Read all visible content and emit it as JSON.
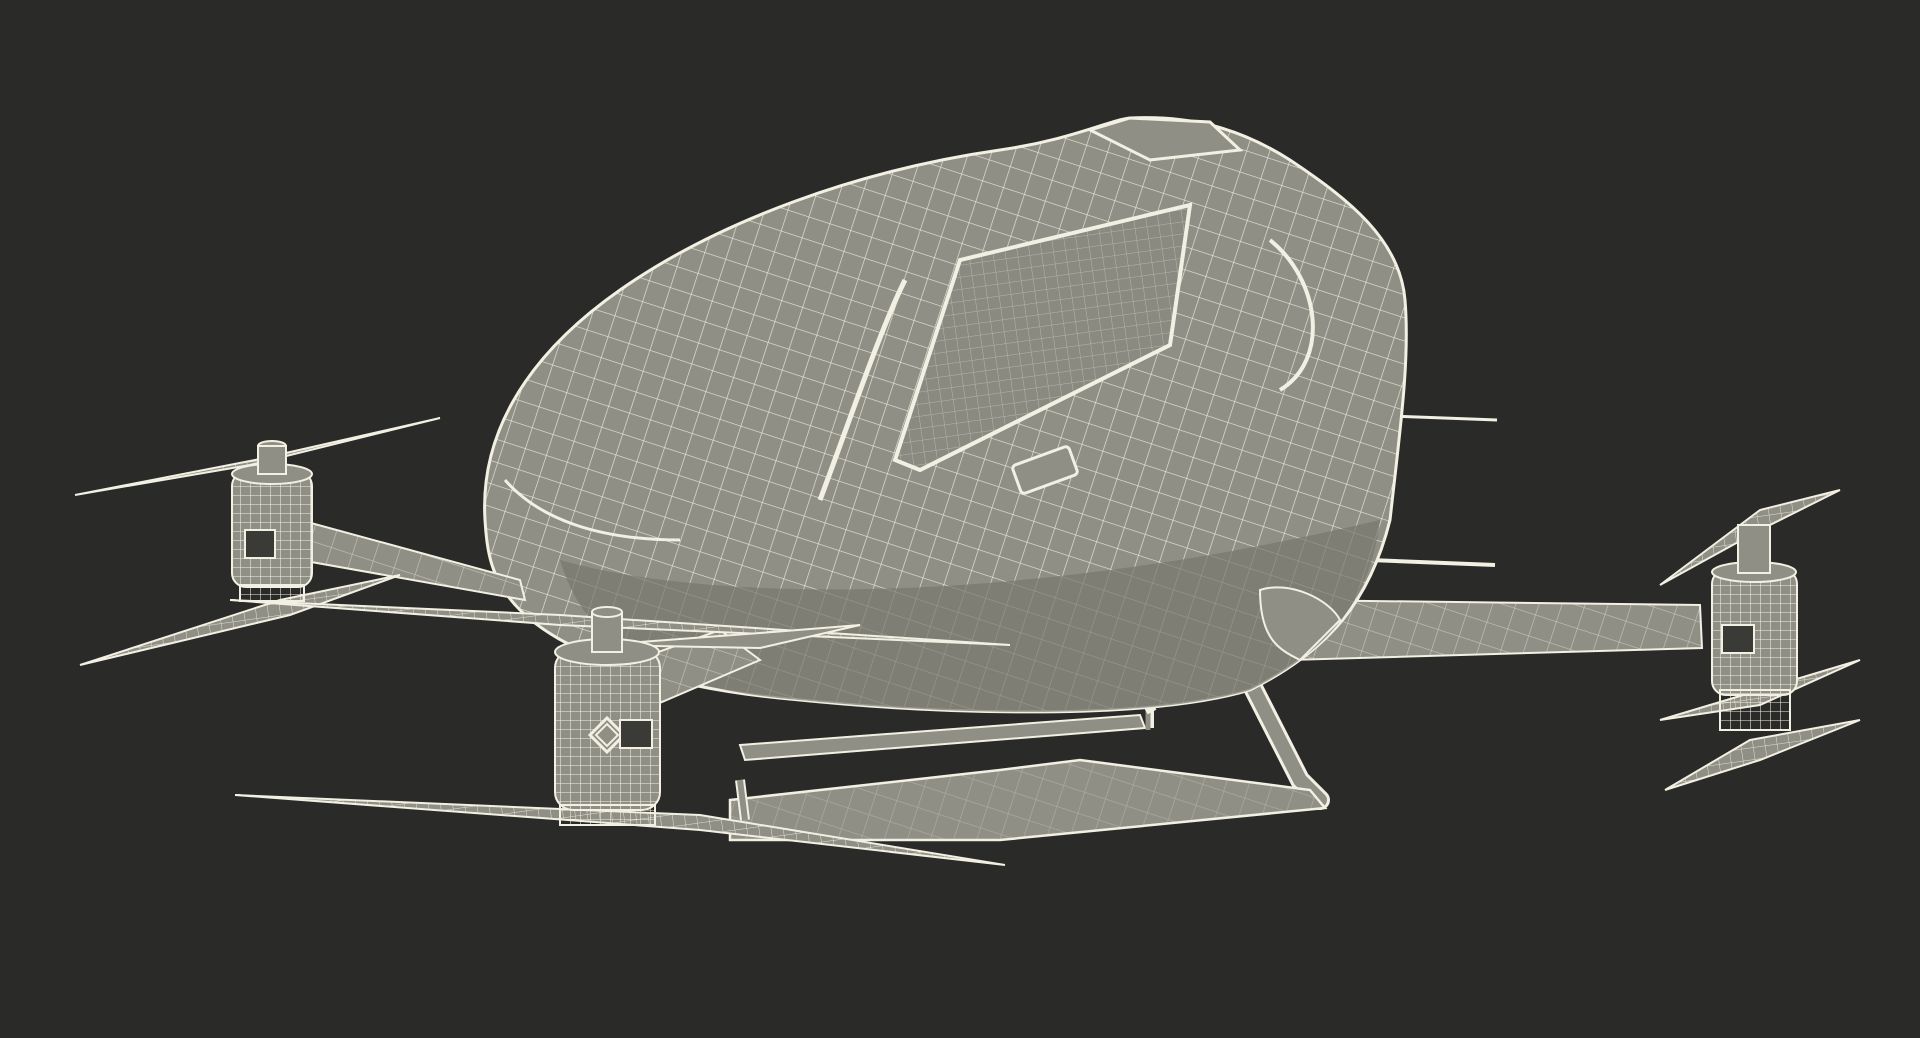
{
  "scene": {
    "background_color": "#2a2a28",
    "surface_color": "#8f8f86",
    "surface_dark_color": "#76766e",
    "wire_color": "#f2f0e2"
  }
}
